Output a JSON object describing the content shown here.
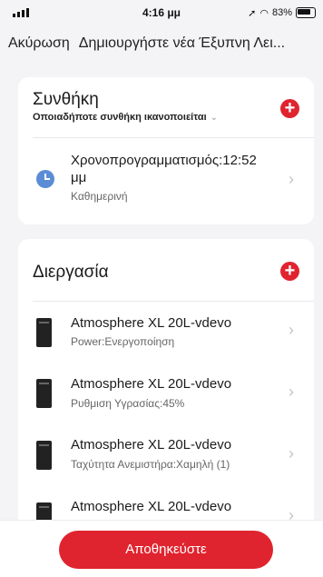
{
  "status": {
    "time": "4:16 μμ",
    "battery": "83%"
  },
  "nav": {
    "cancel": "Ακύρωση",
    "title": "Δημιουργήστε νέα Έξυπνη Λει..."
  },
  "condition": {
    "title": "Συνθήκη",
    "subtitle": "Οποιαδήποτε συνθήκη ικανοποιείται",
    "add": "+",
    "item": {
      "title_line1": "Χρονοπρογραμματισμός:12:52",
      "title_line2": "μμ",
      "sub": "Καθημερινή"
    }
  },
  "process": {
    "title": "Διεργασία",
    "add": "+",
    "items": [
      {
        "title": "Atmosphere XL 20L-vdevo",
        "sub": "Power:Ενεργοποίηση"
      },
      {
        "title": "Atmosphere XL 20L-vdevo",
        "sub": "Ρυθμιση Υγρασίας:45%"
      },
      {
        "title": "Atmosphere XL 20L-vdevo",
        "sub": "Ταχύτητα Ανεμιστήρα:Χαμηλή (1)"
      },
      {
        "title": "Atmosphere XL 20L-vdevo",
        "sub": ""
      }
    ]
  },
  "save": "Αποθηκεύστε",
  "icons": {
    "chevron": "›",
    "subtitle_chevron": "⌄"
  }
}
